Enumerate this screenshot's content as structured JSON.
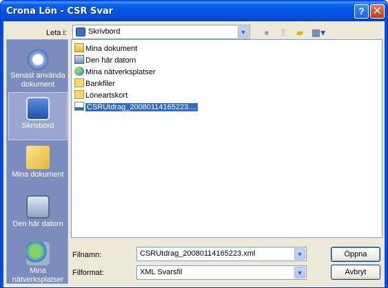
{
  "window": {
    "title": "Crona Lön - CSR Svar",
    "help_label": "?",
    "close_label": "✕"
  },
  "lookin": {
    "label": "Leta i:",
    "value": "Skrivbord",
    "icons": [
      "back-icon",
      "up-folder-icon",
      "new-folder-icon",
      "view-menu-icon"
    ]
  },
  "places": [
    {
      "label": "Senast använda dokument",
      "icon": "recent-documents-icon",
      "selected": false
    },
    {
      "label": "Skrivbord",
      "icon": "desktop-icon",
      "selected": true
    },
    {
      "label": "Mina dokument",
      "icon": "my-documents-icon",
      "selected": false
    },
    {
      "label": "Den här datorn",
      "icon": "my-computer-icon",
      "selected": false
    },
    {
      "label": "Mina nätverksplatser",
      "icon": "network-places-icon",
      "selected": false
    }
  ],
  "files": [
    {
      "name": "Mina dokument",
      "icon": "my-documents-icon"
    },
    {
      "name": "Den här datorn",
      "icon": "my-computer-icon"
    },
    {
      "name": "Mina nätverksplatser",
      "icon": "network-places-icon"
    },
    {
      "name": "Bankfiler",
      "icon": "folder-icon"
    },
    {
      "name": "Löneartskort",
      "icon": "folder-icon"
    },
    {
      "name": "CSRUtdrag_20080114165223....",
      "icon": "xml-file-icon",
      "selected": true
    }
  ],
  "filename": {
    "label": "Filnamn:",
    "value": "CSRUtdrag_20080114165223.xml"
  },
  "filetype": {
    "label": "Filformat:",
    "value": "XML Svarsfil"
  },
  "buttons": {
    "open": "Öppna",
    "cancel": "Avbryt"
  },
  "colors": {
    "titlebar": "#0054e3",
    "dialog_bg": "#ece9d8",
    "places_bg": "#7b8cbd",
    "selection": "#316ac5"
  }
}
